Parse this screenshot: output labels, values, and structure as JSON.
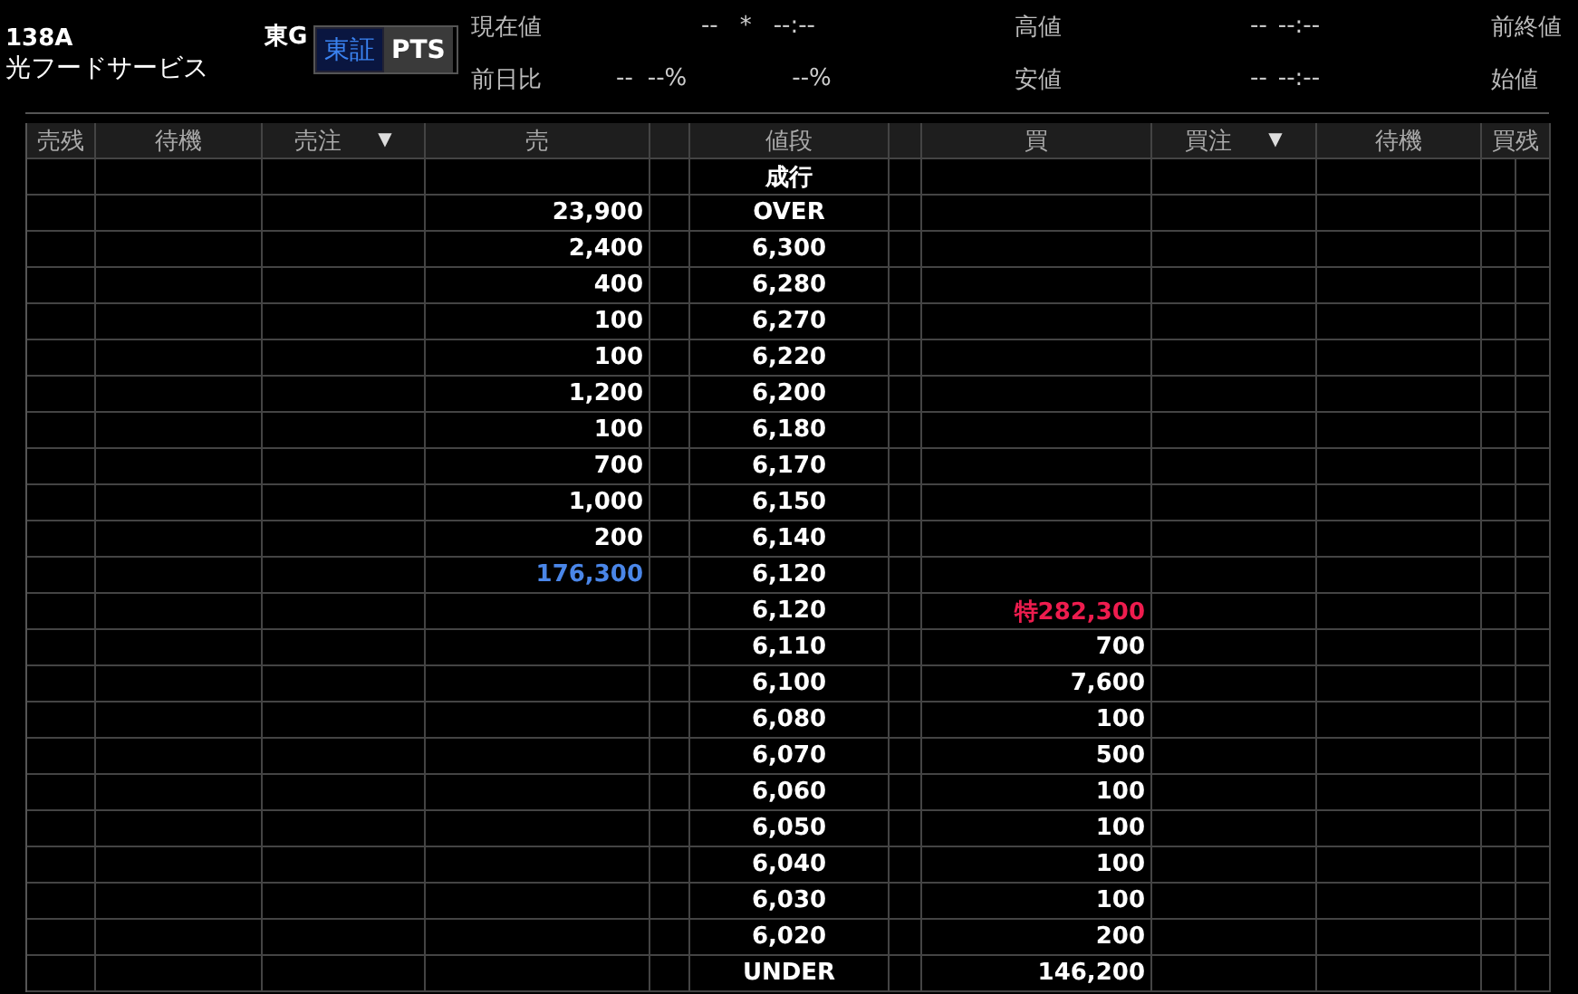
{
  "symbol": {
    "code": "138A",
    "name": "光フードサービス",
    "market": "東G"
  },
  "venues": [
    {
      "label": "東証",
      "selected": true
    },
    {
      "label": "PTS",
      "selected": false
    }
  ],
  "quote": {
    "row_1": [
      {
        "label": "現在値",
        "values": [
          "--",
          "*",
          "--:--"
        ]
      },
      {
        "label": "高値",
        "values": [
          "--",
          "--:--"
        ]
      },
      {
        "label": "前終値"
      }
    ],
    "row_2": [
      {
        "label": "前日比",
        "values": [
          "--",
          "--%",
          "--%"
        ]
      },
      {
        "label": "安値",
        "values": [
          "--",
          "--:--"
        ]
      },
      {
        "label": "始値"
      }
    ]
  },
  "columns": [
    {
      "label": "売残"
    },
    {
      "label": "待機"
    },
    {
      "label": "売注",
      "sort_icon": "▼"
    },
    {
      "label": "売"
    },
    {
      "label": "値段"
    },
    {
      "label": "買"
    },
    {
      "label": "買注",
      "sort_icon": "▼"
    },
    {
      "label": "待機"
    },
    {
      "label": "買残"
    }
  ],
  "rows": [
    {
      "kind": "market",
      "price": "成行"
    },
    {
      "kind": "ask",
      "price": "OVER",
      "quantity": "23,900"
    },
    {
      "kind": "ask",
      "price": "6,300",
      "quantity": "2,400"
    },
    {
      "kind": "ask",
      "price": "6,280",
      "quantity": "400"
    },
    {
      "kind": "ask",
      "price": "6,270",
      "quantity": "100"
    },
    {
      "kind": "ask",
      "price": "6,220",
      "quantity": "100"
    },
    {
      "kind": "ask",
      "price": "6,200",
      "quantity": "1,200"
    },
    {
      "kind": "ask",
      "price": "6,180",
      "quantity": "100"
    },
    {
      "kind": "ask",
      "price": "6,170",
      "quantity": "700"
    },
    {
      "kind": "ask",
      "price": "6,150",
      "quantity": "1,000"
    },
    {
      "kind": "ask",
      "price": "6,140",
      "quantity": "200"
    },
    {
      "kind": "ask_marked",
      "price": "6,120",
      "quantity": "176,300"
    },
    {
      "kind": "bid_marked",
      "price": "6,120",
      "quantity": "特282,300"
    },
    {
      "kind": "bid",
      "price": "6,110",
      "quantity": "700"
    },
    {
      "kind": "bid",
      "price": "6,100",
      "quantity": "7,600"
    },
    {
      "kind": "bid",
      "price": "6,080",
      "quantity": "100"
    },
    {
      "kind": "bid",
      "price": "6,070",
      "quantity": "500"
    },
    {
      "kind": "bid",
      "price": "6,060",
      "quantity": "100"
    },
    {
      "kind": "bid",
      "price": "6,050",
      "quantity": "100"
    },
    {
      "kind": "bid",
      "price": "6,040",
      "quantity": "100"
    },
    {
      "kind": "bid",
      "price": "6,030",
      "quantity": "100"
    },
    {
      "kind": "bid",
      "price": "6,020",
      "quantity": "200"
    },
    {
      "kind": "bid",
      "price": "UNDER",
      "quantity": "146,200"
    }
  ]
}
